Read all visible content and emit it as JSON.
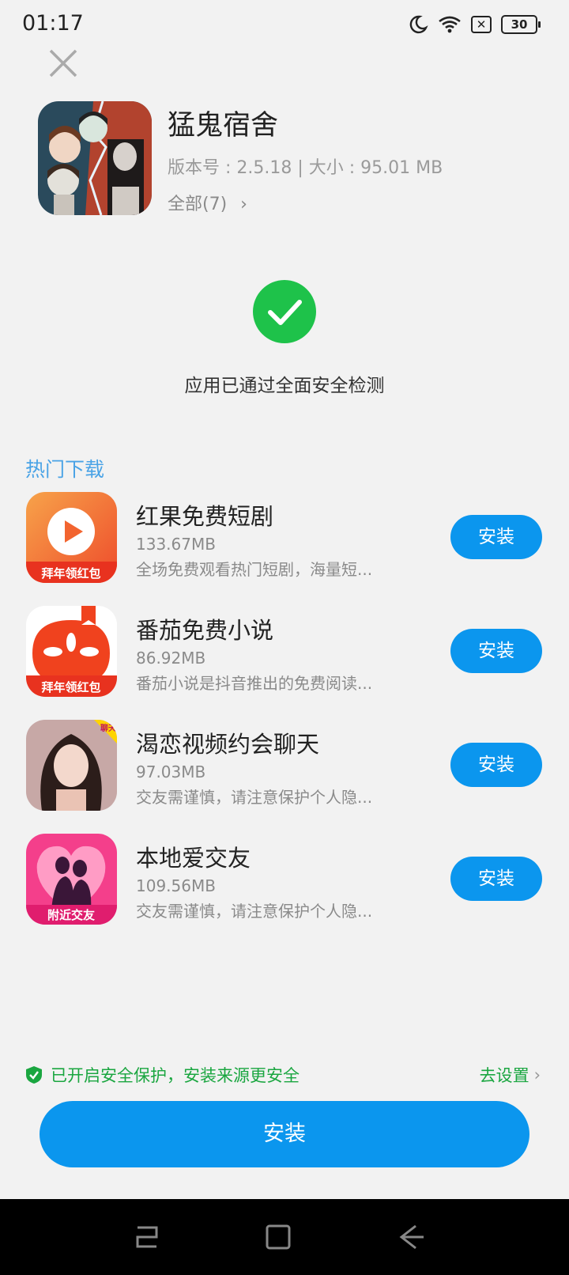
{
  "status_bar": {
    "time": "01:17",
    "battery": "30",
    "sim_mark": "✕"
  },
  "app": {
    "name": "猛鬼宿舍",
    "meta": "版本号 : 2.5.18 | 大小 : 95.01 MB",
    "all_link": "全部(7)"
  },
  "security_check": {
    "message": "应用已通过全面安全检测"
  },
  "hot_downloads": {
    "title": "热门下载",
    "items": [
      {
        "name": "红果免费短剧",
        "size": "133.67MB",
        "desc": "全场免费观看热门短剧，海量短...",
        "button": "安装",
        "icon_banner": "拜年领红包"
      },
      {
        "name": "番茄免费小说",
        "size": "86.92MB",
        "desc": "番茄小说是抖音推出的免费阅读...",
        "button": "安装",
        "icon_banner": "拜年领红包"
      },
      {
        "name": "渴恋视频约会聊天",
        "size": "97.03MB",
        "desc": "交友需谨慎，请注意保护个人隐...",
        "button": "安装",
        "icon_badge": "聊天"
      },
      {
        "name": "本地爱交友",
        "size": "109.56MB",
        "desc": "交友需谨慎，请注意保护个人隐...",
        "button": "安装",
        "icon_banner": "附近交友"
      }
    ]
  },
  "protection": {
    "text": "已开启安全保护，安装来源更安全",
    "settings_link": "去设置"
  },
  "install_button": "安装",
  "colors": {
    "accent": "#0b96ee",
    "success": "#1ec24a",
    "protect_green": "#1aa640",
    "section_blue": "#4aa3e6"
  }
}
